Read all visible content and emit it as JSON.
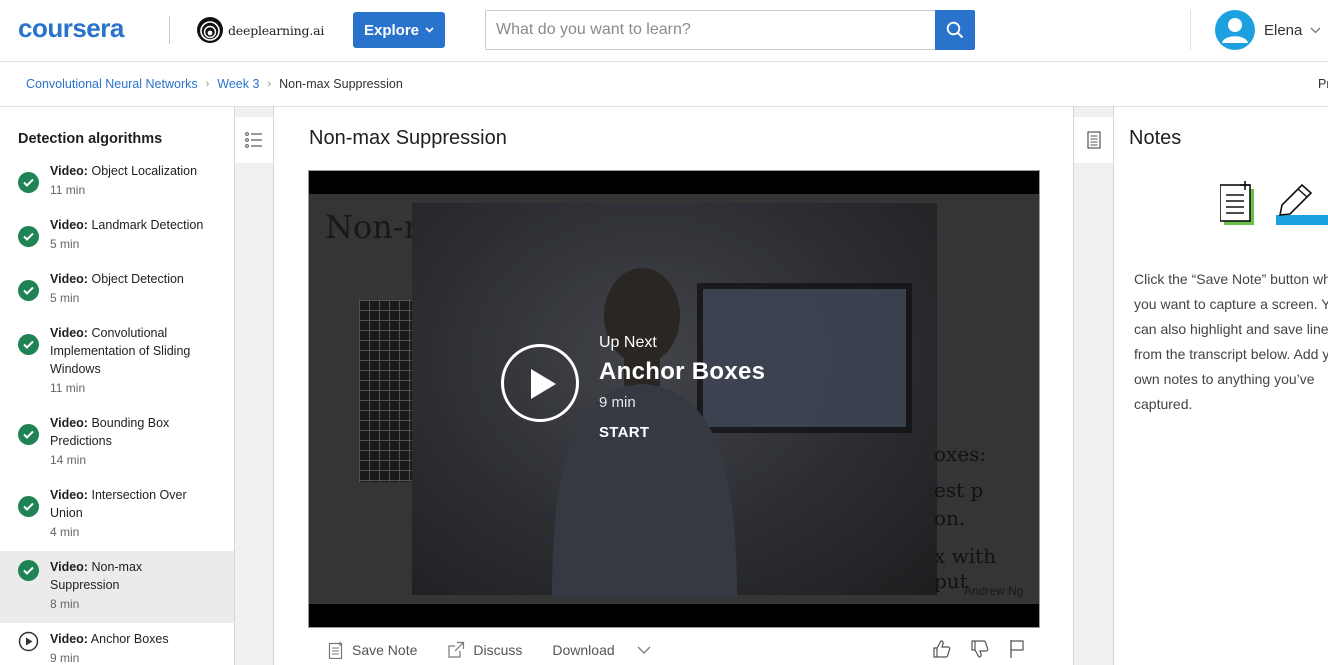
{
  "header": {
    "brand": "coursera",
    "partner": "deeplearning.ai",
    "explore_label": "Explore",
    "search": {
      "placeholder": "What do you want to learn?",
      "value": ""
    },
    "user": {
      "name": "Elena"
    }
  },
  "breadcrumb": {
    "items": [
      "Convolutional Neural Networks",
      "Week 3",
      "Non-max Suppression"
    ],
    "right_truncated": "Pr"
  },
  "sidebar": {
    "section_title": "Detection algorithms",
    "lessons": [
      {
        "type": "Video:",
        "title": "Object Localization",
        "duration": "11 min",
        "status": "completed"
      },
      {
        "type": "Video:",
        "title": "Landmark Detection",
        "duration": "5 min",
        "status": "completed"
      },
      {
        "type": "Video:",
        "title": "Object Detection",
        "duration": "5 min",
        "status": "completed"
      },
      {
        "type": "Video:",
        "title": "Convolutional Implementation of Sliding Windows",
        "duration": "11 min",
        "status": "completed"
      },
      {
        "type": "Video:",
        "title": "Bounding Box Predictions",
        "duration": "14 min",
        "status": "completed"
      },
      {
        "type": "Video:",
        "title": "Intersection Over Union",
        "duration": "4 min",
        "status": "completed"
      },
      {
        "type": "Video:",
        "title": "Non-max Suppression",
        "duration": "8 min",
        "status": "completed",
        "active": true
      },
      {
        "type": "Video:",
        "title": "Anchor Boxes",
        "duration": "9 min",
        "status": "not-started"
      }
    ]
  },
  "main": {
    "lecture_title": "Non-max Suppression",
    "video": {
      "slide_title": "Non-m",
      "slide_fragments": [
        "oxes:",
        "est p",
        "on.",
        "x with",
        "put"
      ],
      "watermark": "Andrew Ng"
    },
    "up_next": {
      "label": "Up Next",
      "title": "Anchor Boxes",
      "duration": "9 min",
      "start_label": "START"
    },
    "toolbar": {
      "save_note": "Save Note",
      "discuss": "Discuss",
      "download": "Download"
    }
  },
  "notes": {
    "title": "Notes",
    "body": "Click the “Save Note” button when you want to capture a screen. You can also highlight and save lines from the transcript below. Add your own notes to anything you’ve captured."
  },
  "colors": {
    "brand_blue": "#2a73cc",
    "completed_green": "#1f8354",
    "avatar_blue": "#1da0e0",
    "active_row": "#ebebeb"
  }
}
